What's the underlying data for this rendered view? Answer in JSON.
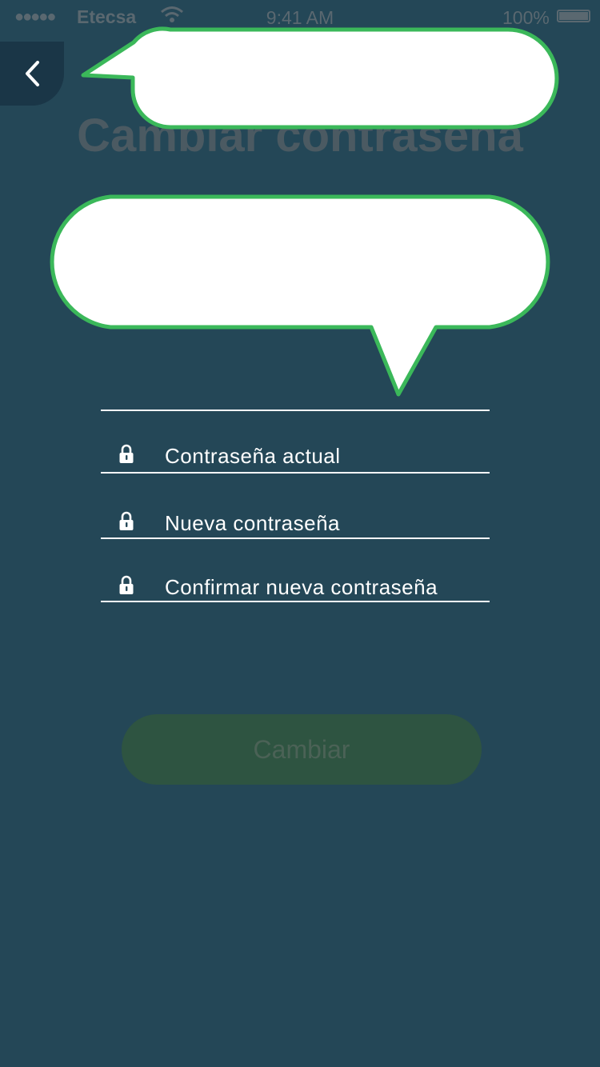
{
  "status_bar": {
    "signal_dots": "●●●●●",
    "carrier": "Etecsa",
    "time": "9:41 AM",
    "battery_percent": "100%",
    "battery_level": 1.0
  },
  "header": {
    "back_icon": "chevron-left-icon",
    "title": "Cambiar contraseña"
  },
  "tooltips": {
    "back_bubble_text": "",
    "info_bubble_text": ""
  },
  "form": {
    "fields": [
      {
        "placeholder": "Contraseña actual",
        "icon": "lock-icon"
      },
      {
        "placeholder": "Nueva contraseña",
        "icon": "lock-icon"
      },
      {
        "placeholder": "Confirmar nueva contraseña",
        "icon": "lock-icon"
      }
    ],
    "submit_label": "Cambiar"
  },
  "colors": {
    "background": "#244757",
    "bubble_border": "#3bb85a",
    "button_bg": "#2e5441"
  }
}
